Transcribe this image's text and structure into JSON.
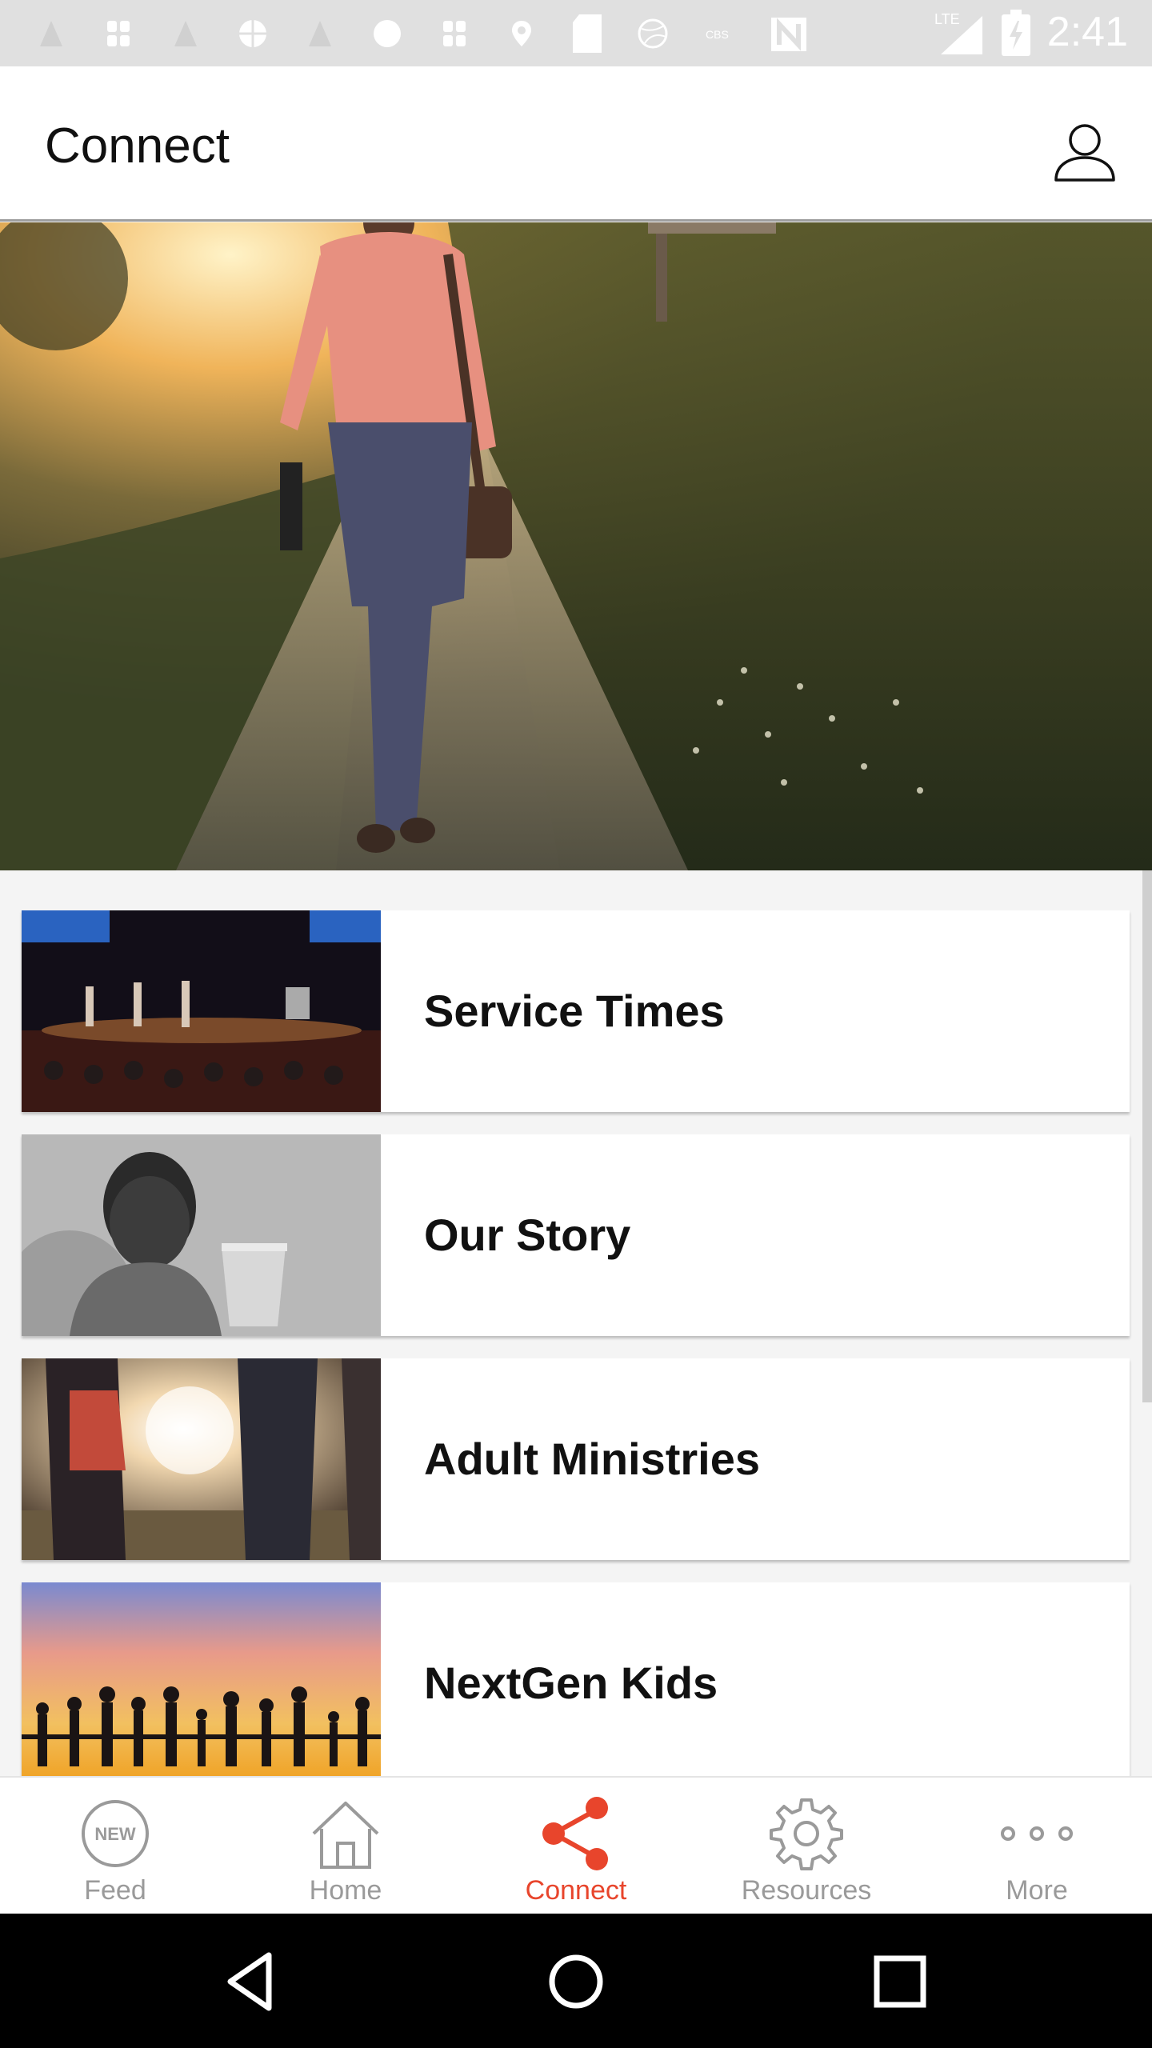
{
  "status_bar": {
    "time": "2:41",
    "network": "LTE",
    "notification_icons": [
      "app-a-icon",
      "app-b-icon",
      "app-c-icon",
      "basketball-icon",
      "app-e-icon",
      "circle-icon",
      "app-g-icon",
      "location-icon",
      "sd-card-icon",
      "dribbble-icon",
      "cbs-icon",
      "n-icon"
    ]
  },
  "header": {
    "title": "Connect"
  },
  "cards": [
    {
      "label": "Service Times",
      "image": "church-worship-stage-image"
    },
    {
      "label": "Our Story",
      "image": "child-with-cup-bw-image"
    },
    {
      "label": "Adult Ministries",
      "image": "holding-hands-sunset-image"
    },
    {
      "label": "NextGen Kids",
      "image": "silhouettes-sunset-image"
    }
  ],
  "bottom_nav": [
    {
      "label": "Feed",
      "icon": "new-badge-icon",
      "active": false
    },
    {
      "label": "Home",
      "icon": "home-icon",
      "active": false
    },
    {
      "label": "Connect",
      "icon": "share-icon",
      "active": true
    },
    {
      "label": "Resources",
      "icon": "gear-icon",
      "active": false
    },
    {
      "label": "More",
      "icon": "more-dots-icon",
      "active": false
    }
  ],
  "colors": {
    "accent": "#e8452c",
    "inactive": "#9a9a9a",
    "status_bar": "#e0e0e0",
    "system_nav": "#000000"
  }
}
